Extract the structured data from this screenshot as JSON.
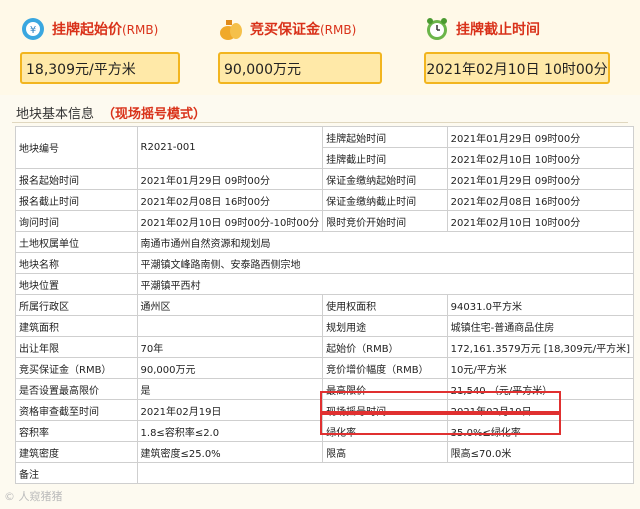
{
  "stats": [
    {
      "label": "挂牌起始价",
      "unit": "(RMB)",
      "value": "18,309元/平方米",
      "icon": "price-tag-icon"
    },
    {
      "label": "竞买保证金",
      "unit": "(RMB)",
      "value": "90,000万元",
      "icon": "money-bag-icon"
    },
    {
      "label": "挂牌截止时间",
      "unit": "",
      "value": "2021年02月10日  10时00分",
      "icon": "alarm-clock-icon"
    }
  ],
  "section": {
    "title": "地块基本信息",
    "mode": "（现场摇号模式）"
  },
  "rows": {
    "r1": {
      "l1": "地块编号",
      "v1": "R2021-001",
      "l2": "挂牌起始时间",
      "v2": "2021年01月29日 09时00分",
      "l3": "挂牌截止时间",
      "v3": "2021年02月10日 10时00分"
    },
    "r2": {
      "l1": "报名起始时间",
      "v1": "2021年01月29日 09时00分",
      "l2": "保证金缴纳起始时间",
      "v2": "2021年01月29日 09时00分"
    },
    "r3": {
      "l1": "报名截止时间",
      "v1": "2021年02月08日 16时00分",
      "l2": "保证金缴纳截止时间",
      "v2": "2021年02月08日 16时00分"
    },
    "r4": {
      "l1": "询问时间",
      "v1": "2021年02月10日 09时00分-10时00分",
      "l2": "限时竞价开始时间",
      "v2": "2021年02月10日 10时00分"
    },
    "r5": {
      "l1": "土地权属单位",
      "v1": "南通市通州自然资源和规划局"
    },
    "r6": {
      "l1": "地块名称",
      "v1": "平潮镇文峰路南侧、安泰路西侧宗地"
    },
    "r7": {
      "l1": "地块位置",
      "v1": "平潮镇平西村"
    },
    "r8": {
      "l1": "所属行政区",
      "v1": "通州区",
      "l2": "使用权面积",
      "v2": "94031.0平方米"
    },
    "r9": {
      "l1": "建筑面积",
      "v1": "",
      "l2": "规划用途",
      "v2": "城镇住宅-普通商品住房"
    },
    "r10": {
      "l1": "出让年限",
      "v1": "70年",
      "l2": "起始价（RMB）",
      "v2": "172,161.3579万元 [18,309元/平方米]"
    },
    "r11": {
      "l1": "竞买保证金（RMB）",
      "v1": "90,000万元",
      "l2": "竞价增价幅度（RMB）",
      "v2": "10元/平方米"
    },
    "r12": {
      "l1": "是否设置最高限价",
      "v1": "是",
      "l2": "最高限价",
      "v2": "21,540 （元/平方米）"
    },
    "r13": {
      "l1": "资格审查截至时间",
      "v1": "2021年02月19日",
      "l2": "现场摇号时间",
      "v2": "2021年02月19日"
    },
    "r14": {
      "l1": "容积率",
      "v1": "1.8≤容积率≤2.0",
      "l2": "绿化率",
      "v2": "35.0%≤绿化率"
    },
    "r15": {
      "l1": "建筑密度",
      "v1": "建筑密度≤25.0%",
      "l2": "限高",
      "v2": "限高≤70.0米"
    },
    "r16": {
      "l1": "备注",
      "v1": ""
    }
  },
  "watermark": "©  人窥猪猪",
  "colors": {
    "accent": "#d9321a",
    "box_fill": "#ffe9a8",
    "box_border": "#f2b51f",
    "highlight": "#e03030"
  }
}
